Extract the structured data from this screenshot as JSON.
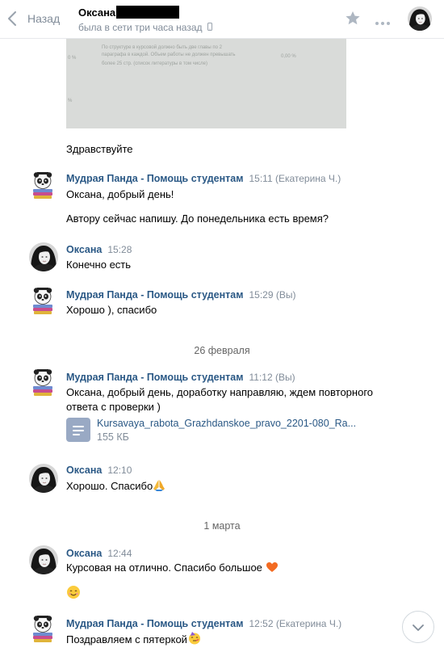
{
  "header": {
    "back_label": "Назад",
    "peer_name": "Оксана",
    "peer_status": "была в сети три часа назад"
  },
  "photo": {
    "line1": "По структуре в курсовой должно быть две главы по 2",
    "line2": "параграфа в каждой. Объем работы не должен превышать",
    "line3": "более 25 стр. (список литературы в том числе)",
    "pct_left": "0 %",
    "pct_right": "0,00 %",
    "pct_bottom": "%"
  },
  "messages": {
    "m0": {
      "text": "Здравствуйте"
    },
    "m1": {
      "author": "Мудрая Панда - Помощь студентам",
      "meta": "15:11 (Екатерина Ч.)",
      "text1": "Оксана, добрый день!",
      "text2": "Автору сейчас напишу. До понедельника есть время?"
    },
    "m2": {
      "author": "Оксана",
      "meta": "15:28",
      "text": "Конечно есть"
    },
    "m3": {
      "author": "Мудрая Панда - Помощь студентам",
      "meta": "15:29 (Вы)",
      "text": "Хорошо ), спасибо"
    },
    "date1": "26 февраля",
    "m4": {
      "author": "Мудрая Панда - Помощь студентам",
      "meta": "11:12 (Вы)",
      "text1": "Оксана, добрый день, доработку направляю, ждем повторного",
      "text2": "ответа с проверки )",
      "doc_name": "Kursavaya_rabota_Grazhdanskoe_pravo_2201-080_Ra...",
      "doc_size": "155 КБ"
    },
    "m5": {
      "author": "Оксана",
      "meta": "12:10",
      "text": "Хорошо. Спасибо"
    },
    "date2": "1 марта",
    "m6": {
      "author": "Оксана",
      "meta": "12:44",
      "text": "Курсовая на отлично. Спасибо большое "
    },
    "m7": {
      "author": "Мудрая Панда - Помощь студентам",
      "meta": "12:52 (Екатерина Ч.)",
      "text": "Поздравляем с пятеркой"
    }
  },
  "colors": {
    "link": "#2a5885",
    "muted": "#818c99",
    "doc_icon": "#99a9c4"
  },
  "icons": {
    "back": "chevron-left-icon",
    "star": "star-icon",
    "more": "more-dots-icon",
    "phone": "mobile-phone-icon",
    "scroll": "chevron-down-icon",
    "doc": "document-icon"
  }
}
